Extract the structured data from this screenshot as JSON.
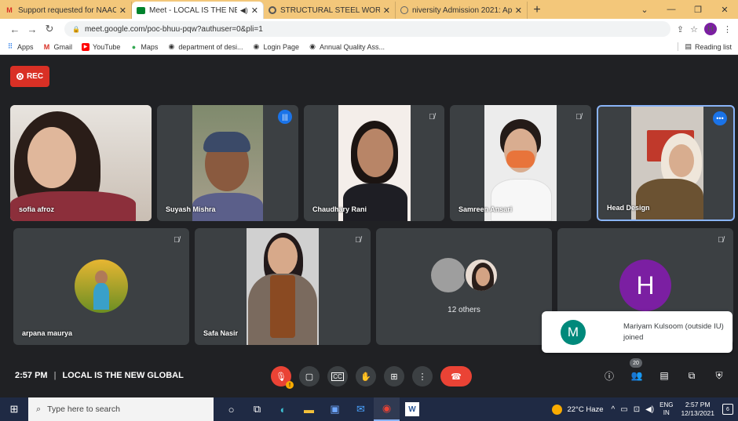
{
  "browser": {
    "tabs": [
      {
        "title": "Support requested for NAAC Crit",
        "icon": "gmail-icon"
      },
      {
        "title": "Meet - LOCAL IS THE NEW G",
        "icon": "meet-icon"
      },
      {
        "title": "STRUCTURAL STEEL WORK Unit",
        "icon": "chrome-page-icon"
      },
      {
        "title": "niversity Admission 2021: Applic",
        "icon": "globe-icon"
      }
    ],
    "url": "meet.google.com/poc-bhuu-pqw?authuser=0&pli=1",
    "profile_initial": "H",
    "bookmarks": [
      "Apps",
      "Gmail",
      "YouTube",
      "Maps",
      "department of desi...",
      "Login Page",
      "Annual Quality Ass..."
    ],
    "reading_list": "Reading list"
  },
  "meet": {
    "rec_label": "REC",
    "participants": [
      {
        "name": "sofia afroz"
      },
      {
        "name": "Suyash Mishra"
      },
      {
        "name": "Chaudhary Rani"
      },
      {
        "name": "Samreen Ansari"
      },
      {
        "name": "Head Design"
      },
      {
        "name": "arpana maurya"
      },
      {
        "name": "Safa Nasir"
      },
      {
        "name": "12 others"
      },
      {
        "name": "H"
      }
    ],
    "toast": {
      "initial": "M",
      "text": "Mariyam Kulsoom (outside IU) joined"
    },
    "time": "2:57 PM",
    "meeting_title": "LOCAL IS THE NEW GLOBAL",
    "people_count": "20"
  },
  "taskbar": {
    "search_placeholder": "Type here to search",
    "weather": "22°C  Haze",
    "lang_line1": "ENG",
    "lang_line2": "IN",
    "clock_time": "2:57 PM",
    "clock_date": "12/13/2021",
    "notif_count": "6"
  },
  "colors": {
    "accent_blue": "#1a73e8",
    "rec_red": "#d93025",
    "meet_bg": "#202124",
    "tile_bg": "#3c4043",
    "tabbar": "#f3c77a"
  }
}
